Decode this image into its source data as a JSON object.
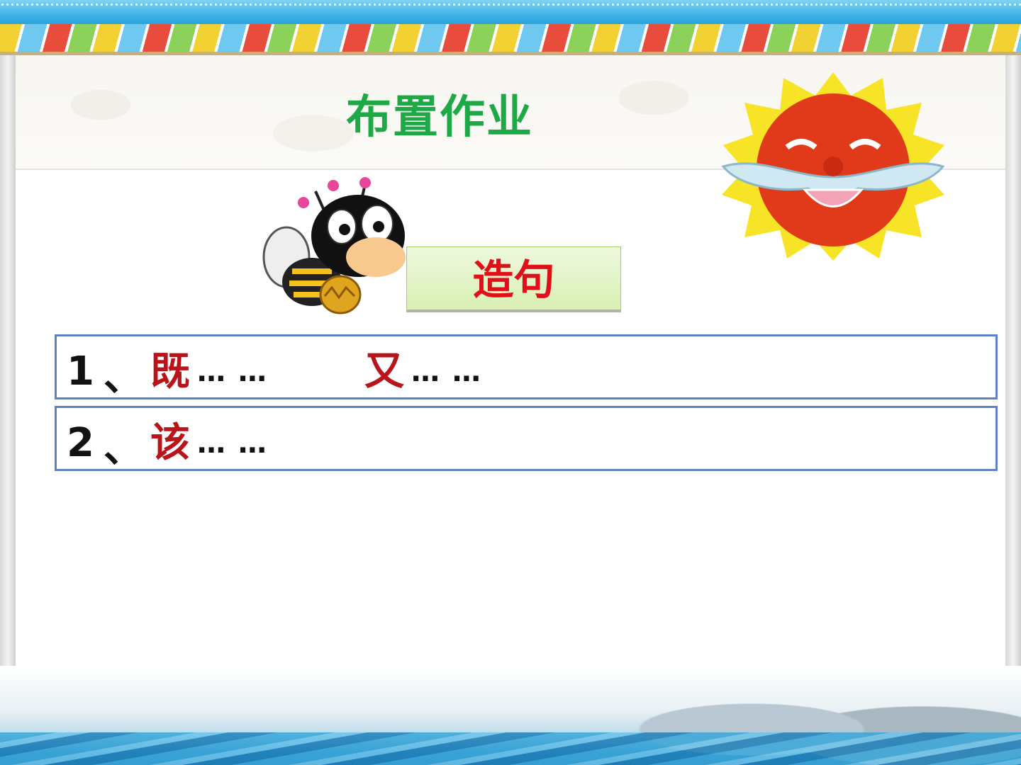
{
  "slide": {
    "title": "布置作业",
    "task_label": "造句",
    "items": [
      {
        "number": "1",
        "separator": "、",
        "keyword_1": "既",
        "dots_1": "… …",
        "keyword_2": "又",
        "dots_2": "… …"
      },
      {
        "number": "2",
        "separator": "、",
        "keyword_1": "该",
        "dots_1": "… …"
      }
    ]
  },
  "colors": {
    "title": "#1fa846",
    "task_label": "#e0101a",
    "keyword": "#b8141a",
    "row_border": "#5f83c0"
  },
  "icons": [
    "bee-mascot-illustration",
    "smiling-sun-illustration"
  ]
}
